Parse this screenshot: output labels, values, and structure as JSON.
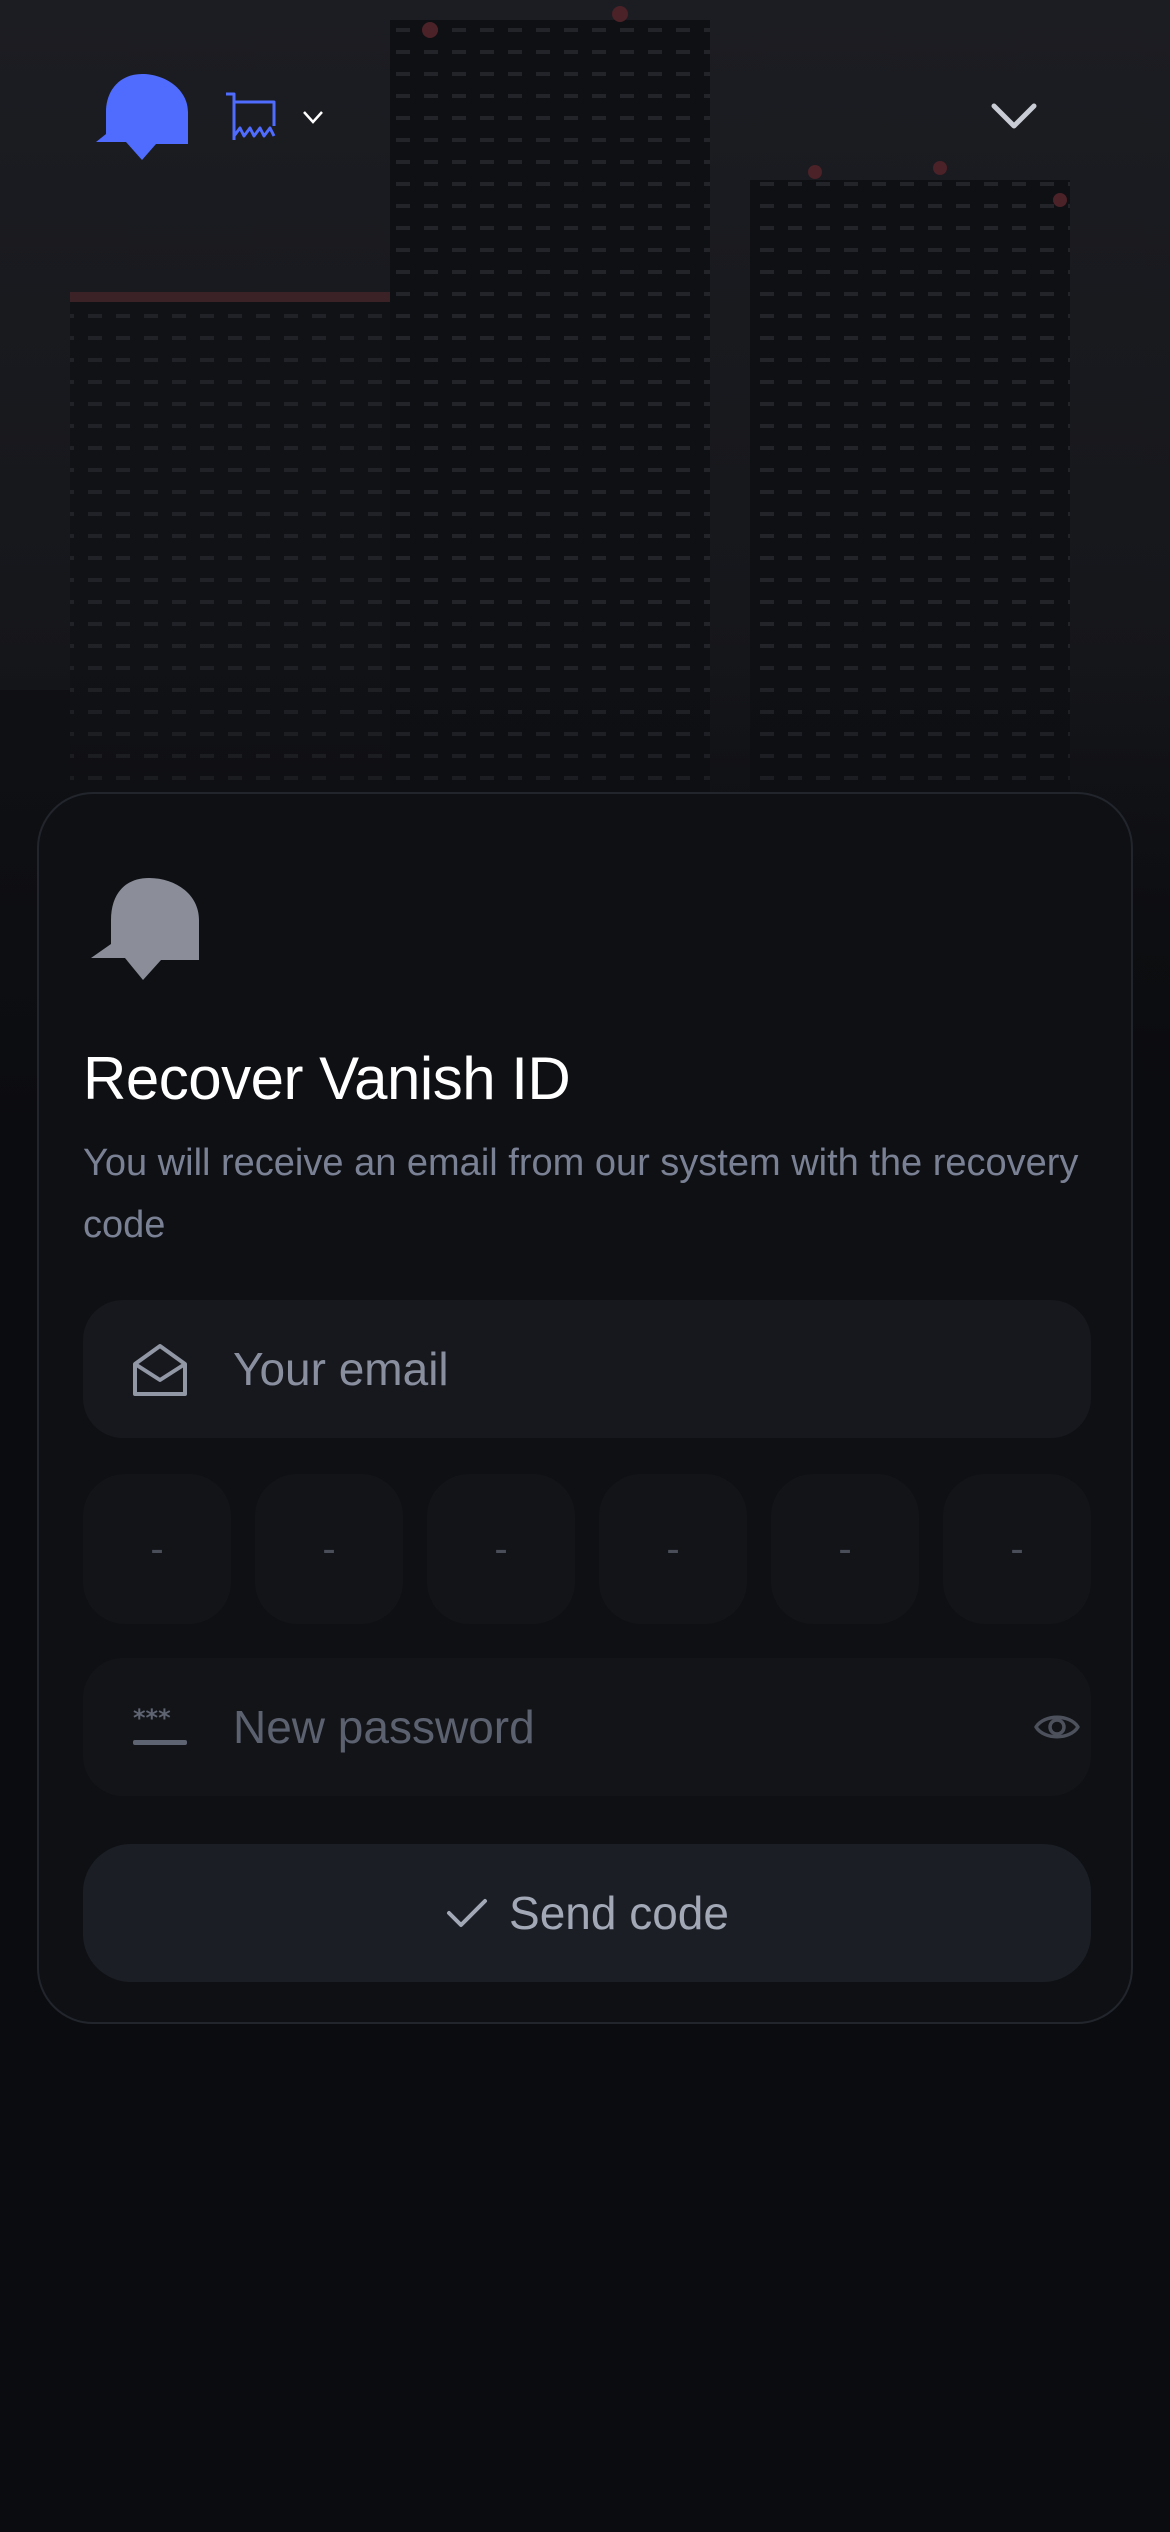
{
  "header": {
    "logo_icon": "ghost-logo-icon",
    "store_icon": "storefront-icon",
    "brand_color": "#4f6cff"
  },
  "card": {
    "logo_icon": "ghost-logo-icon",
    "title": "Recover Vanish ID",
    "subtitle": "You will receive an email from our system with the recovery code",
    "email": {
      "placeholder": "Your email",
      "value": "",
      "icon": "envelope-open-icon"
    },
    "code_digits": [
      "-",
      "-",
      "-",
      "-",
      "-",
      "-"
    ],
    "password": {
      "placeholder": "New password",
      "value": "",
      "icon": "password-dots-icon",
      "toggle_icon": "eye-icon"
    },
    "submit": {
      "label": "Send code",
      "icon": "check-icon"
    }
  }
}
